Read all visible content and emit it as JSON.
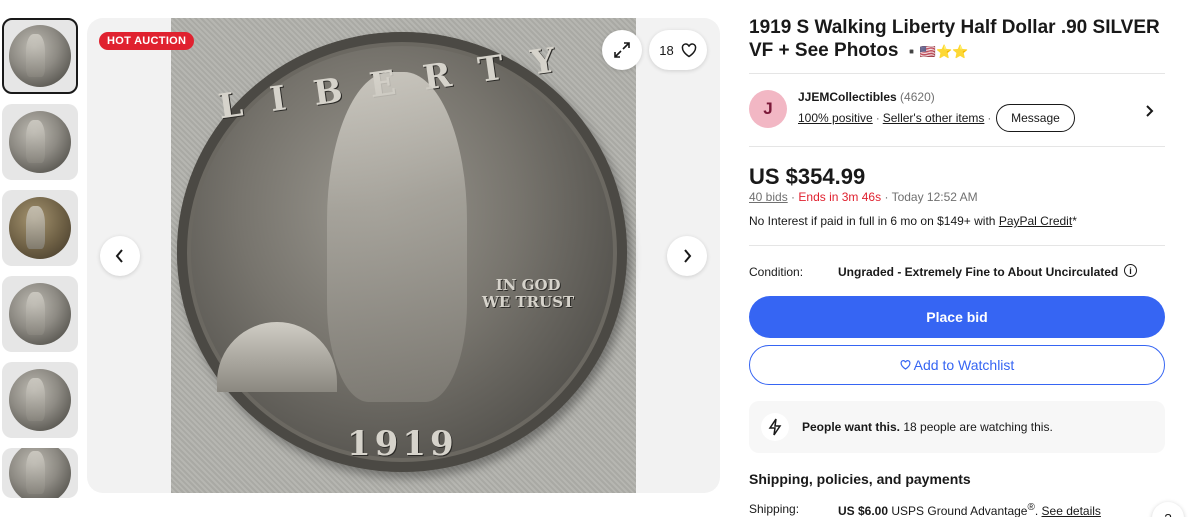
{
  "gallery": {
    "thumbnail_count": 6,
    "active_index": 0,
    "badge": "HOT AUCTION",
    "watch_count": "18",
    "icons": {
      "expand": "expand-icon",
      "heart": "heart-icon",
      "prev": "chevron-left-icon",
      "next": "chevron-right-icon"
    },
    "coin": {
      "year": "1919",
      "motto_line1": "IN GOD",
      "motto_line2": "WE TRUST",
      "legend": "LIBERTY"
    }
  },
  "listing": {
    "title": "1919 S Walking Liberty Half Dollar .90 SILVER VF + See Photos",
    "title_flags": "▪️🇺🇸⭐⭐"
  },
  "seller": {
    "avatar_letter": "J",
    "name": "JJEMCollectibles",
    "feedback_count": "(4620)",
    "positive": "100% positive",
    "other_items": "Seller's other items",
    "message_label": "Message"
  },
  "pricing": {
    "price": "US $354.99",
    "bids": "40 bids",
    "ends": "Ends in 3m 46s",
    "end_time": "Today 12:52 AM",
    "credit_text": "No Interest if paid in full in 6 mo on $149+ with ",
    "credit_link": "PayPal Credit",
    "credit_suffix": "*"
  },
  "condition": {
    "label": "Condition:",
    "value": "Ungraded - Extremely Fine to About Uncirculated"
  },
  "actions": {
    "place_bid": "Place bid",
    "add_watchlist": "Add to Watchlist"
  },
  "social_proof": {
    "bold": "People want this.",
    "text": " 18 people are watching this."
  },
  "shipping": {
    "heading": "Shipping, policies, and payments",
    "label": "Shipping:",
    "cost": "US $6.00",
    "service": " USPS Ground Advantage",
    "registered": "®",
    "details_sep": ". ",
    "details_link": "See details"
  },
  "colors": {
    "primary": "#3665f3",
    "hot": "#e0212f",
    "avatar_bg": "#f2b7c4"
  }
}
